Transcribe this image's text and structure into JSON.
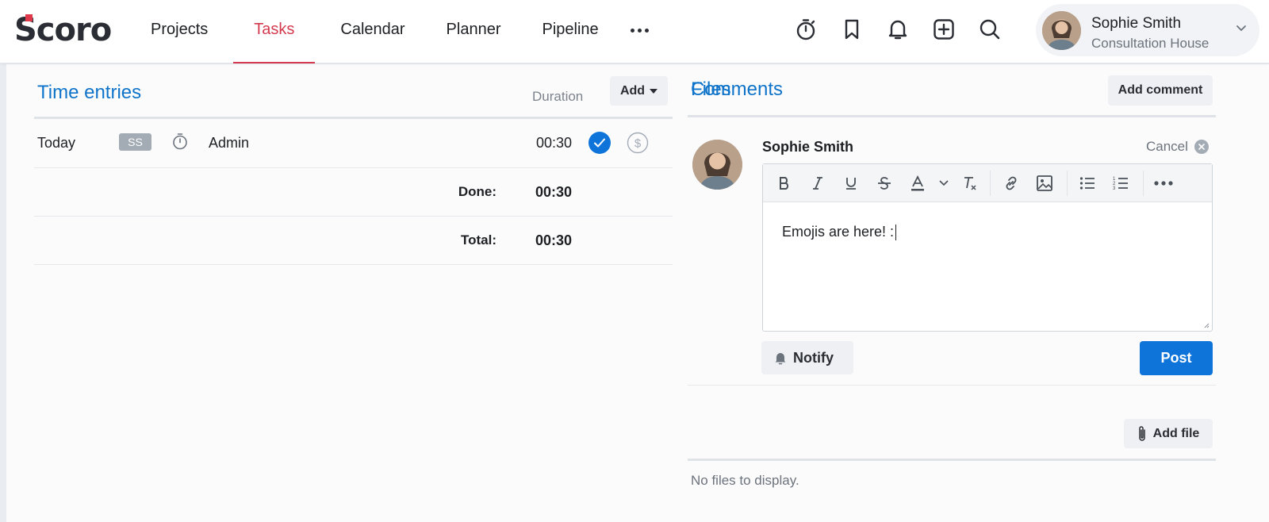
{
  "nav": {
    "logo_text": "Scoro",
    "items": [
      {
        "label": "Projects",
        "active": false
      },
      {
        "label": "Tasks",
        "active": true
      },
      {
        "label": "Calendar",
        "active": false
      },
      {
        "label": "Planner",
        "active": false
      },
      {
        "label": "Pipeline",
        "active": false
      }
    ],
    "icons": [
      "timer-icon",
      "bookmark-icon",
      "bell-icon",
      "plus-square-icon",
      "search-icon"
    ]
  },
  "user": {
    "name": "Sophie Smith",
    "company": "Consultation House"
  },
  "time_entries": {
    "title": "Time entries",
    "duration_header": "Duration",
    "add_label": "Add",
    "rows": [
      {
        "date": "Today",
        "user_initials": "SS",
        "activity": "Admin",
        "duration": "00:30",
        "done": true,
        "billable": false
      }
    ],
    "done_label": "Done:",
    "done_value": "00:30",
    "total_label": "Total:",
    "total_value": "00:30"
  },
  "comments": {
    "title": "Comments",
    "add_label": "Add comment",
    "author": "Sophie Smith",
    "cancel_label": "Cancel",
    "draft_text": "Emojis are here! :",
    "notify_label": "Notify",
    "post_label": "Post"
  },
  "files": {
    "title": "Files",
    "add_label": "Add file",
    "empty_text": "No files to display."
  },
  "colors": {
    "accent_blue": "#0f74d9",
    "title_blue": "#0f74c9",
    "active_red": "#d43a4e",
    "logo_red": "#e0394b"
  }
}
